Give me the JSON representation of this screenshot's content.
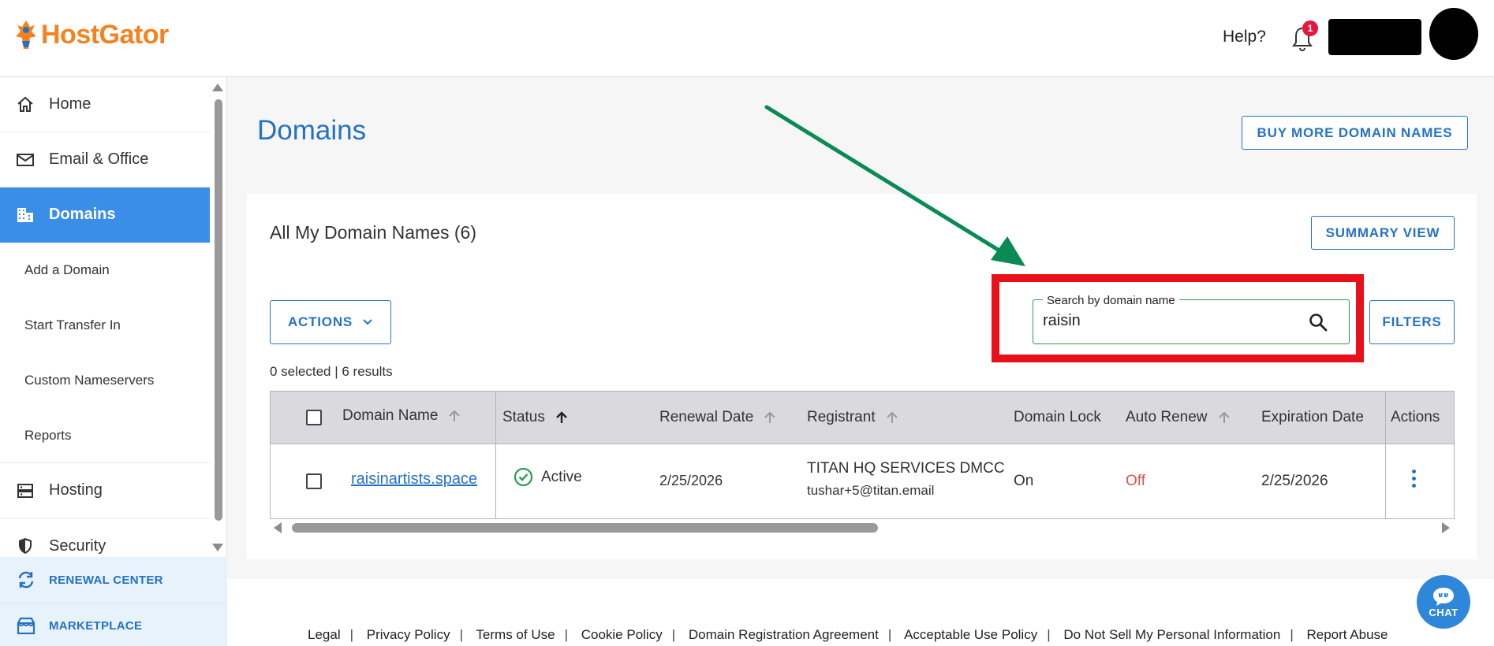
{
  "header": {
    "logo_text": "HostGator",
    "help_label": "Help?",
    "notification_count": "1"
  },
  "sidebar": {
    "items": [
      {
        "label": "Home",
        "icon": "home-icon"
      },
      {
        "label": "Email & Office",
        "icon": "mail-icon"
      },
      {
        "label": "Domains",
        "icon": "domains-icon",
        "active": true
      },
      {
        "label": "Add a Domain"
      },
      {
        "label": "Start Transfer In"
      },
      {
        "label": "Custom Nameservers"
      },
      {
        "label": "Reports"
      },
      {
        "label": "Hosting",
        "icon": "server-icon"
      },
      {
        "label": "Security",
        "icon": "shield-icon"
      }
    ],
    "promo": [
      {
        "label": "RENEWAL CENTER",
        "icon": "refresh-icon"
      },
      {
        "label": "MARKETPLACE",
        "icon": "store-icon"
      }
    ]
  },
  "main": {
    "title": "Domains",
    "buy_more_label": "BUY MORE DOMAIN NAMES",
    "card_title": "All My Domain Names (6)",
    "summary_view_label": "SUMMARY VIEW",
    "actions_label": "ACTIONS",
    "search": {
      "legend": "Search by domain name",
      "value": "raisin"
    },
    "filters_label": "FILTERS",
    "results_text": "0 selected | 6 results"
  },
  "table": {
    "columns": [
      "Domain Name",
      "Status",
      "Renewal Date",
      "Registrant",
      "Domain Lock",
      "Auto Renew",
      "Expiration Date",
      "Actions"
    ],
    "rows": [
      {
        "domain": "raisinartists.space",
        "status": "Active",
        "renewal_date": "2/25/2026",
        "registrant_name": "TITAN HQ SERVICES DMCC",
        "registrant_email": "tushar+5@titan.email",
        "domain_lock": "On",
        "auto_renew": "Off",
        "expiration_date": "2/25/2026"
      }
    ]
  },
  "footer": {
    "links": [
      "Legal",
      "Privacy Policy",
      "Terms of Use",
      "Cookie Policy",
      "Domain Registration Agreement",
      "Acceptable Use Policy",
      "Do Not Sell My Personal Information",
      "Report Abuse"
    ]
  },
  "chat_label": "CHAT",
  "colors": {
    "brand_orange": "#f58220",
    "accent_blue": "#2572c4",
    "nav_active": "#3b8ee8",
    "highlight_red": "#e8101a",
    "annotation_green": "#0a8a55",
    "status_green": "#2e9b54",
    "off_red": "#d9534f"
  }
}
